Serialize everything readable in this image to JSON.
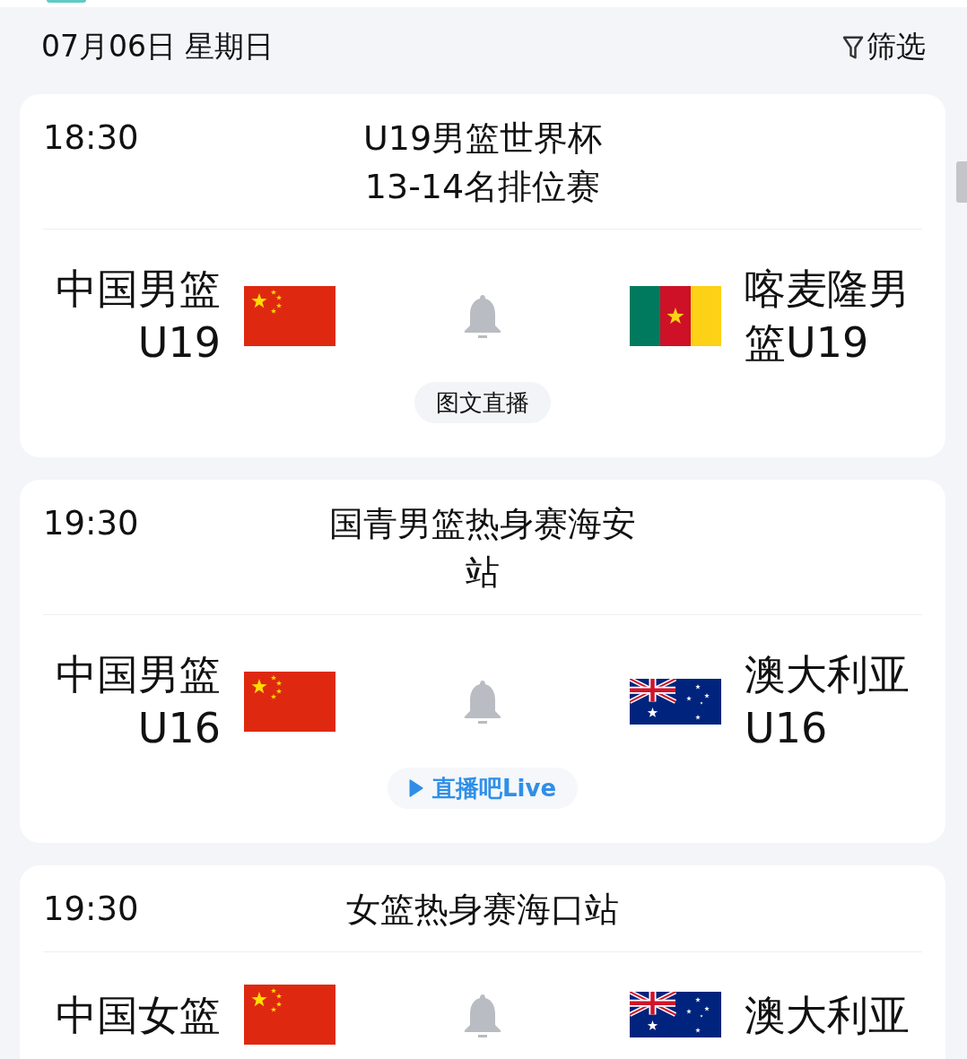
{
  "date": "07月06日 星期日",
  "filter": {
    "label": "筛选"
  },
  "matches": [
    {
      "time": "18:30",
      "title_lines": [
        "U19男篮世界杯",
        "13-14名排位赛"
      ],
      "home": {
        "name_lines": [
          "中国男篮",
          "U19"
        ],
        "flag": {
          "kind": "china"
        }
      },
      "away": {
        "name_lines": [
          "喀麦隆男",
          "篮U19"
        ],
        "flag": {
          "kind": "cameroon"
        }
      },
      "broadcast": {
        "kind": "text",
        "label": "图文直播"
      }
    },
    {
      "time": "19:30",
      "title_lines": [
        "国青男篮热身赛海安",
        "站"
      ],
      "home": {
        "name_lines": [
          "中国男篮",
          "U16"
        ],
        "flag": {
          "kind": "china"
        }
      },
      "away": {
        "name_lines": [
          "澳大利亚",
          "U16"
        ],
        "flag": {
          "kind": "australia"
        }
      },
      "broadcast": {
        "kind": "video",
        "label": "直播吧Live"
      }
    },
    {
      "time": "19:30",
      "title_lines": [
        "女篮热身赛海口站"
      ],
      "home": {
        "name_lines": [
          "中国女篮"
        ],
        "flag": {
          "kind": "china"
        }
      },
      "away": {
        "name_lines": [
          "澳大利亚"
        ],
        "flag": {
          "kind": "australia"
        }
      }
    }
  ]
}
